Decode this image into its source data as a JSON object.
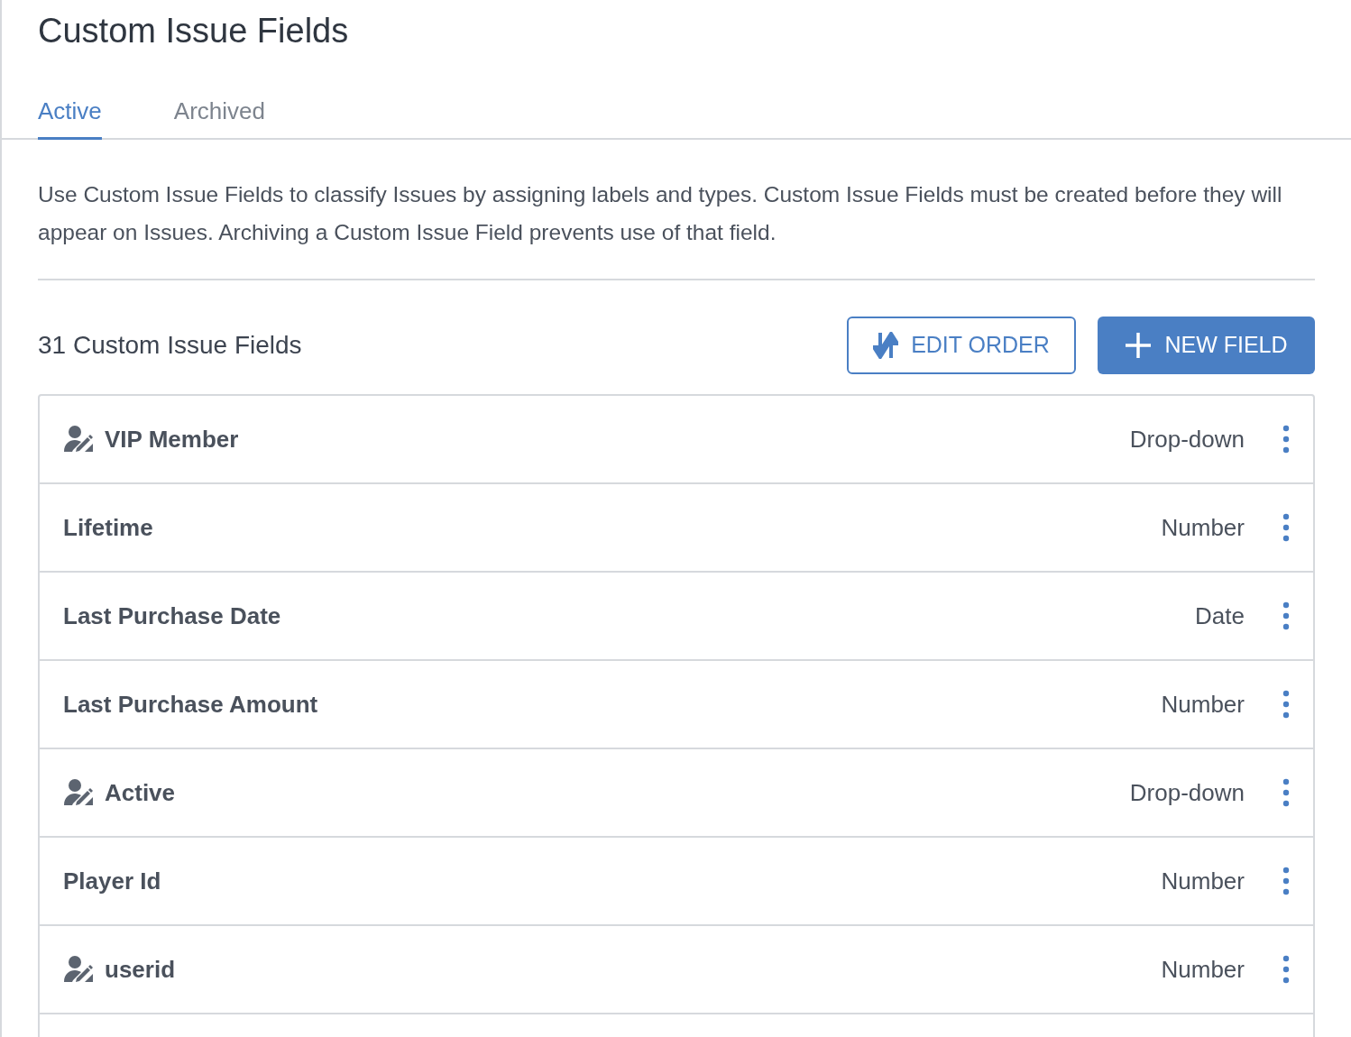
{
  "title": "Custom Issue Fields",
  "tabs": [
    {
      "label": "Active",
      "selected": true
    },
    {
      "label": "Archived",
      "selected": false
    }
  ],
  "description": "Use Custom Issue Fields to classify Issues by assigning labels and types. Custom Issue Fields must be created before they will appear on Issues. Archiving a Custom Issue Field prevents use of that field.",
  "count_label": "31 Custom Issue Fields",
  "edit_order_button": "EDIT ORDER",
  "new_field_button": "NEW FIELD",
  "fields": [
    {
      "name": "VIP Member",
      "type": "Drop-down",
      "kind": "user"
    },
    {
      "name": "Lifetime",
      "type": "Number",
      "kind": "plain"
    },
    {
      "name": "Last Purchase Date",
      "type": "Date",
      "kind": "plain"
    },
    {
      "name": "Last Purchase Amount",
      "type": "Number",
      "kind": "plain"
    },
    {
      "name": "Active",
      "type": "Drop-down",
      "kind": "user"
    },
    {
      "name": "Player Id",
      "type": "Number",
      "kind": "plain"
    },
    {
      "name": "userid",
      "type": "Number",
      "kind": "user"
    }
  ]
}
